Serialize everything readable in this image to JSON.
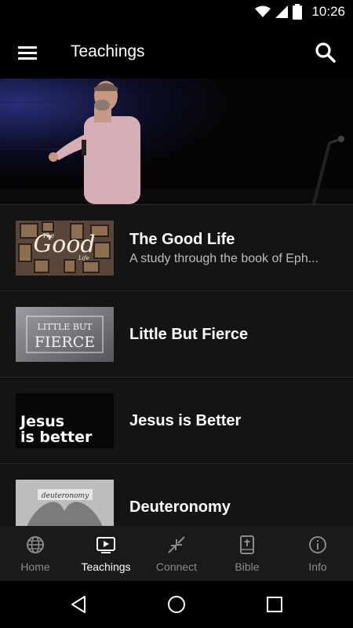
{
  "status_bar": {
    "time": "10:26"
  },
  "app_bar": {
    "title": "Teachings"
  },
  "teachings": [
    {
      "title": "The Good Life",
      "subtitle": "A study through the book of Eph..."
    },
    {
      "title": "Little But Fierce",
      "subtitle": ""
    },
    {
      "title": "Jesus is Better",
      "subtitle": ""
    },
    {
      "title": "Deuteronomy",
      "subtitle": ""
    }
  ],
  "thumbnail_text": {
    "good_life_main": "Good",
    "good_life_small_top": "The",
    "good_life_small_bottom": "Life",
    "little_but": "LITTLE BUT",
    "fierce": "FIERCE",
    "jesus_line1": "Jesus",
    "jesus_line2": "is better",
    "deuteronomy": "deuteronomy"
  },
  "bottom_nav": {
    "items": [
      {
        "label": "Home",
        "icon": "globe-icon"
      },
      {
        "label": "Teachings",
        "icon": "tv-icon"
      },
      {
        "label": "Connect",
        "icon": "collapse-arrows-icon"
      },
      {
        "label": "Bible",
        "icon": "bible-icon"
      },
      {
        "label": "Info",
        "icon": "info-icon"
      }
    ],
    "active_index": 1
  }
}
